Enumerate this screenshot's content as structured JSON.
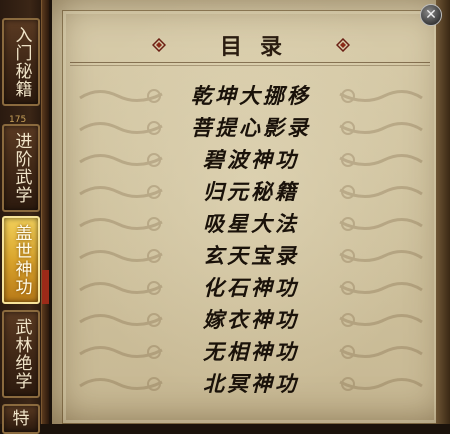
{
  "sidebar": {
    "tabs": [
      {
        "label": "入门秘籍",
        "active": false
      },
      {
        "label": "进阶武学",
        "active": false
      },
      {
        "label": "盖世神功",
        "active": true
      },
      {
        "label": "武林绝学",
        "active": false
      },
      {
        "label": "特",
        "active": false
      }
    ],
    "badge": "175"
  },
  "panel": {
    "title": "目录",
    "close_glyph": "✕",
    "entries": [
      "乾坤大挪移",
      "菩提心影录",
      "碧波神功",
      "归元秘籍",
      "吸星大法",
      "玄天宝录",
      "化石神功",
      "嫁衣神功",
      "无相神功",
      "北冥神功"
    ]
  },
  "colors": {
    "parchment": "#d3c6a2",
    "ink": "#1a120a",
    "tab_active": "#e0b03a",
    "tab_inactive": "#4a2f1b"
  }
}
